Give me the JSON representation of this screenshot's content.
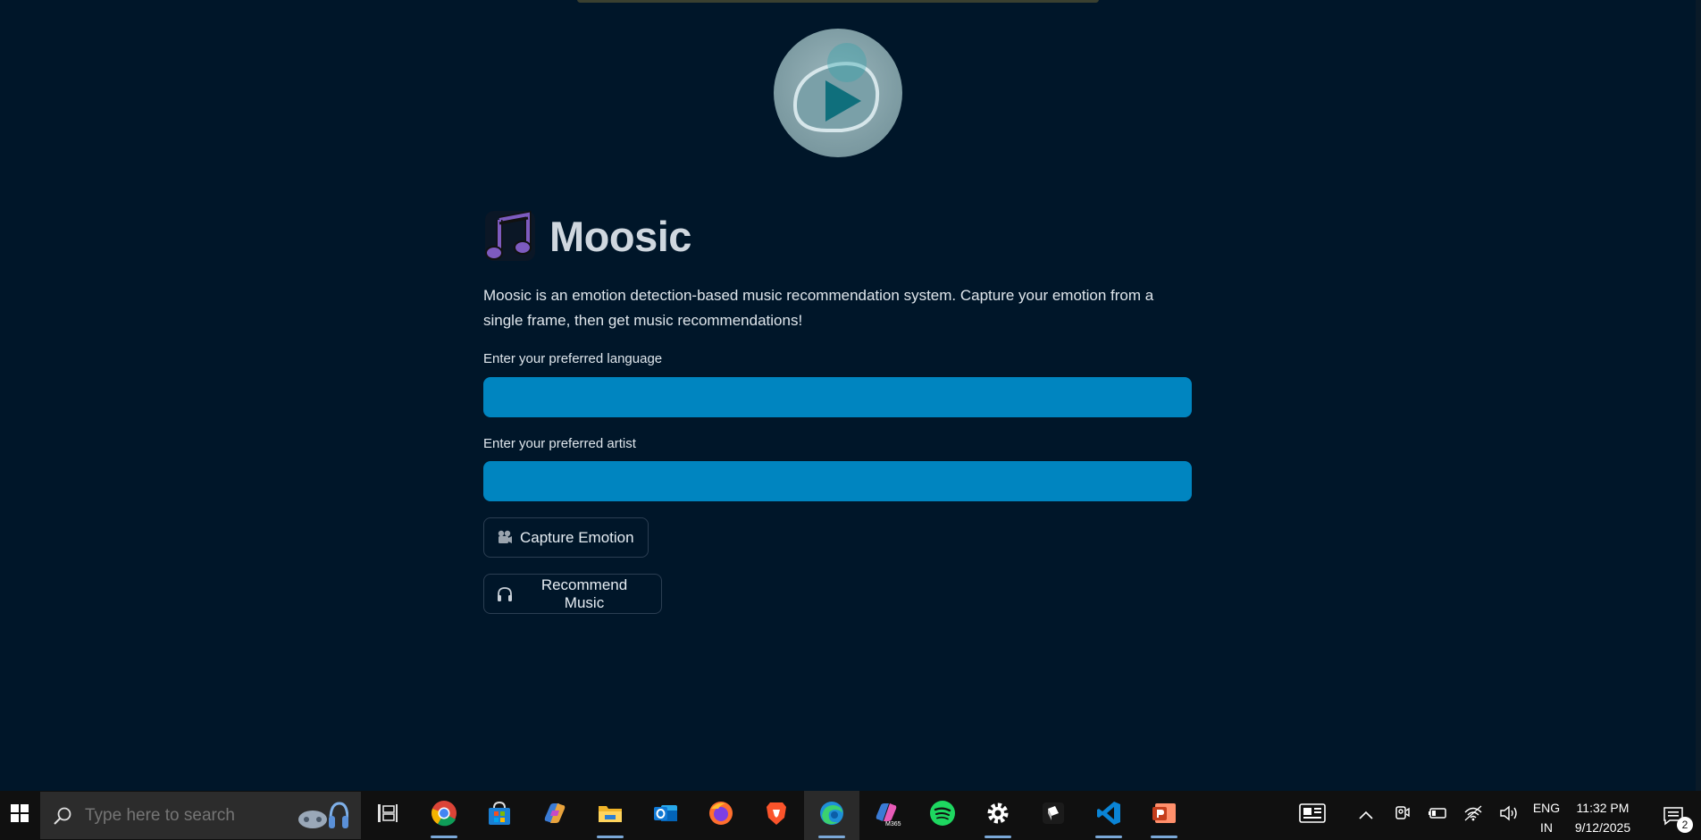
{
  "app": {
    "title": "Moosic",
    "description": "Moosic is an emotion detection-based music recommendation system. Capture your emotion from a single frame, then get music recommendations!",
    "language_label": "Enter your preferred language",
    "language_value": "",
    "artist_label": "Enter your preferred artist",
    "artist_value": "",
    "capture_button": "Capture Emotion",
    "recommend_button": "Recommend Music",
    "colors": {
      "background": "#001629",
      "input": "#0085c0",
      "title": "#cfd7df"
    }
  },
  "taskbar": {
    "search_placeholder": "Type here to search",
    "apps": [
      "chrome",
      "microsoft-store",
      "copilot",
      "file-explorer",
      "outlook",
      "firefox",
      "brave",
      "edge",
      "microsoft-365",
      "spotify",
      "settings",
      "roblox",
      "vscode",
      "powerpoint"
    ],
    "language_top": "ENG",
    "language_bottom": "IN",
    "time": "11:32 PM",
    "date": "9/12/2025",
    "notification_count": "2"
  }
}
